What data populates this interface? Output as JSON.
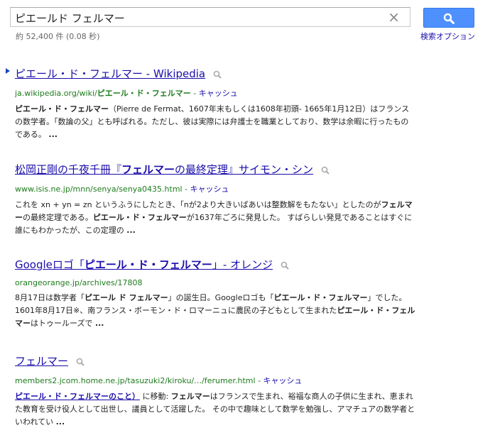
{
  "search": {
    "query": "ピエールド フェルマー",
    "clear_icon": "×",
    "button_icon": "search-icon",
    "stats": "約 52,400 件 (0.08 秒)",
    "options_label": "検索オプション"
  },
  "results": [
    {
      "title": "ピエール・ド・フェルマー",
      "title_suffix": " - Wikipedia",
      "url_prefix": "ja.wikipedia.org/wiki/",
      "url_bold": "ピエール・ド・フェルマー",
      "cache": "キャッシュ",
      "snippet_parts": [
        {
          "t": "ピエール・ド・フェルマー",
          "b": true
        },
        {
          "t": "（Pierre de Fermat、1607年末もしくは1608年初頭- 1665年1月12日）はフランスの数学者。「数論の父」とも呼ばれる。ただし、彼は実際には弁護士を職業としており、数学は余暇に行ったものである。 ",
          "b": false
        },
        {
          "t": "...",
          "b": true
        }
      ]
    },
    {
      "title_parts": [
        {
          "t": "松岡正剛の千夜千冊『",
          "b": false
        },
        {
          "t": "フェルマー",
          "b": true
        },
        {
          "t": "の最終定理』サイモン・シン",
          "b": false
        }
      ],
      "url": "www.isis.ne.jp/mnn/senya/senya0435.html",
      "cache": "キャッシュ",
      "snippet_parts": [
        {
          "t": "これを xn + yn = zn というふうにしたとき、「nが2より大きいばあいは整数解をもたない」としたのが",
          "b": false
        },
        {
          "t": "フェルマー",
          "b": true
        },
        {
          "t": "の最終定理である。",
          "b": false
        },
        {
          "t": "ピエール・ド・フェルマー",
          "b": true
        },
        {
          "t": "が1637年ごろに発見した。 すばらしい発見であることはすぐに誰にもわかったが、この定理の ",
          "b": false
        },
        {
          "t": "...",
          "b": true
        }
      ]
    },
    {
      "title_parts": [
        {
          "t": "Googleロゴ「",
          "b": false
        },
        {
          "t": "ピエール・ド・フェルマー",
          "b": true
        },
        {
          "t": "」- オレンジ",
          "b": false
        }
      ],
      "url": "orangeorange.jp/archives/17808",
      "snippet_parts": [
        {
          "t": "8月17日は数学者「",
          "b": false
        },
        {
          "t": "ピエール ド フェルマー",
          "b": true
        },
        {
          "t": "」の誕生日。Googleロゴも「",
          "b": false
        },
        {
          "t": "ピエール・ド・フェルマー",
          "b": true
        },
        {
          "t": "」でした。 1601年8月17日※、南フランス・ボーモン・ド・ロマーニュに農民の子どもとして生まれた",
          "b": false
        },
        {
          "t": "ピエール・ド・フェルマー",
          "b": true
        },
        {
          "t": "はトゥールーズで ",
          "b": false
        },
        {
          "t": "...",
          "b": true
        }
      ]
    },
    {
      "title": "フェルマー",
      "url": "members2.jcom.home.ne.jp/tasuzuki2/kiroku/…/ferumer.html",
      "cache": "キャッシュ",
      "jump_link": "ピエール・ド・フェルマーのこと）",
      "snippet_parts": [
        {
          "t": " に移動: ",
          "b": false
        },
        {
          "t": "フェルマー",
          "b": true
        },
        {
          "t": "はフランスで生まれ、裕福な商人の子供に生まれ、恵まれた教育を受け役人として出世し、議員として活躍した。 その中で趣味として数学を勉強し、アマチュアの数学者といわれてい ",
          "b": false
        },
        {
          "t": "...",
          "b": true
        }
      ]
    }
  ]
}
